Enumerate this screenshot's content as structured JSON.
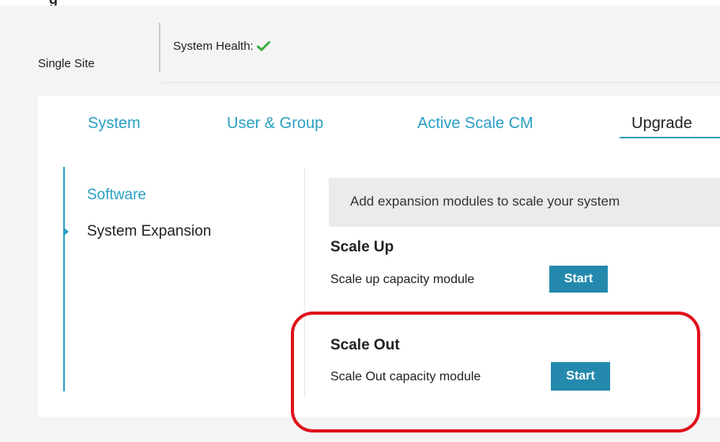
{
  "header": {
    "site_label": "Single Site",
    "health_label": "System Health:",
    "health_status_icon": "check-icon",
    "health_status_color": "#3cb043"
  },
  "tabs": [
    {
      "label": "System",
      "active": false
    },
    {
      "label": "User & Group",
      "active": false
    },
    {
      "label": "Active Scale CM",
      "active": false
    },
    {
      "label": "Upgrade",
      "active": true
    }
  ],
  "sidebar": {
    "items": [
      {
        "label": "Software",
        "active": false
      },
      {
        "label": "System Expansion",
        "active": true
      }
    ]
  },
  "main": {
    "banner_text": "Add expansion modules to scale your system",
    "scale_up": {
      "title": "Scale Up",
      "description": "Scale up capacity module",
      "button_label": "Start"
    },
    "scale_out": {
      "title": "Scale Out",
      "description": "Scale Out capacity module",
      "button_label": "Start"
    }
  },
  "colors": {
    "accent": "#2a9fc3",
    "button": "#2489ad",
    "highlight": "#e0111b",
    "banner_bg": "#ebebeb"
  }
}
